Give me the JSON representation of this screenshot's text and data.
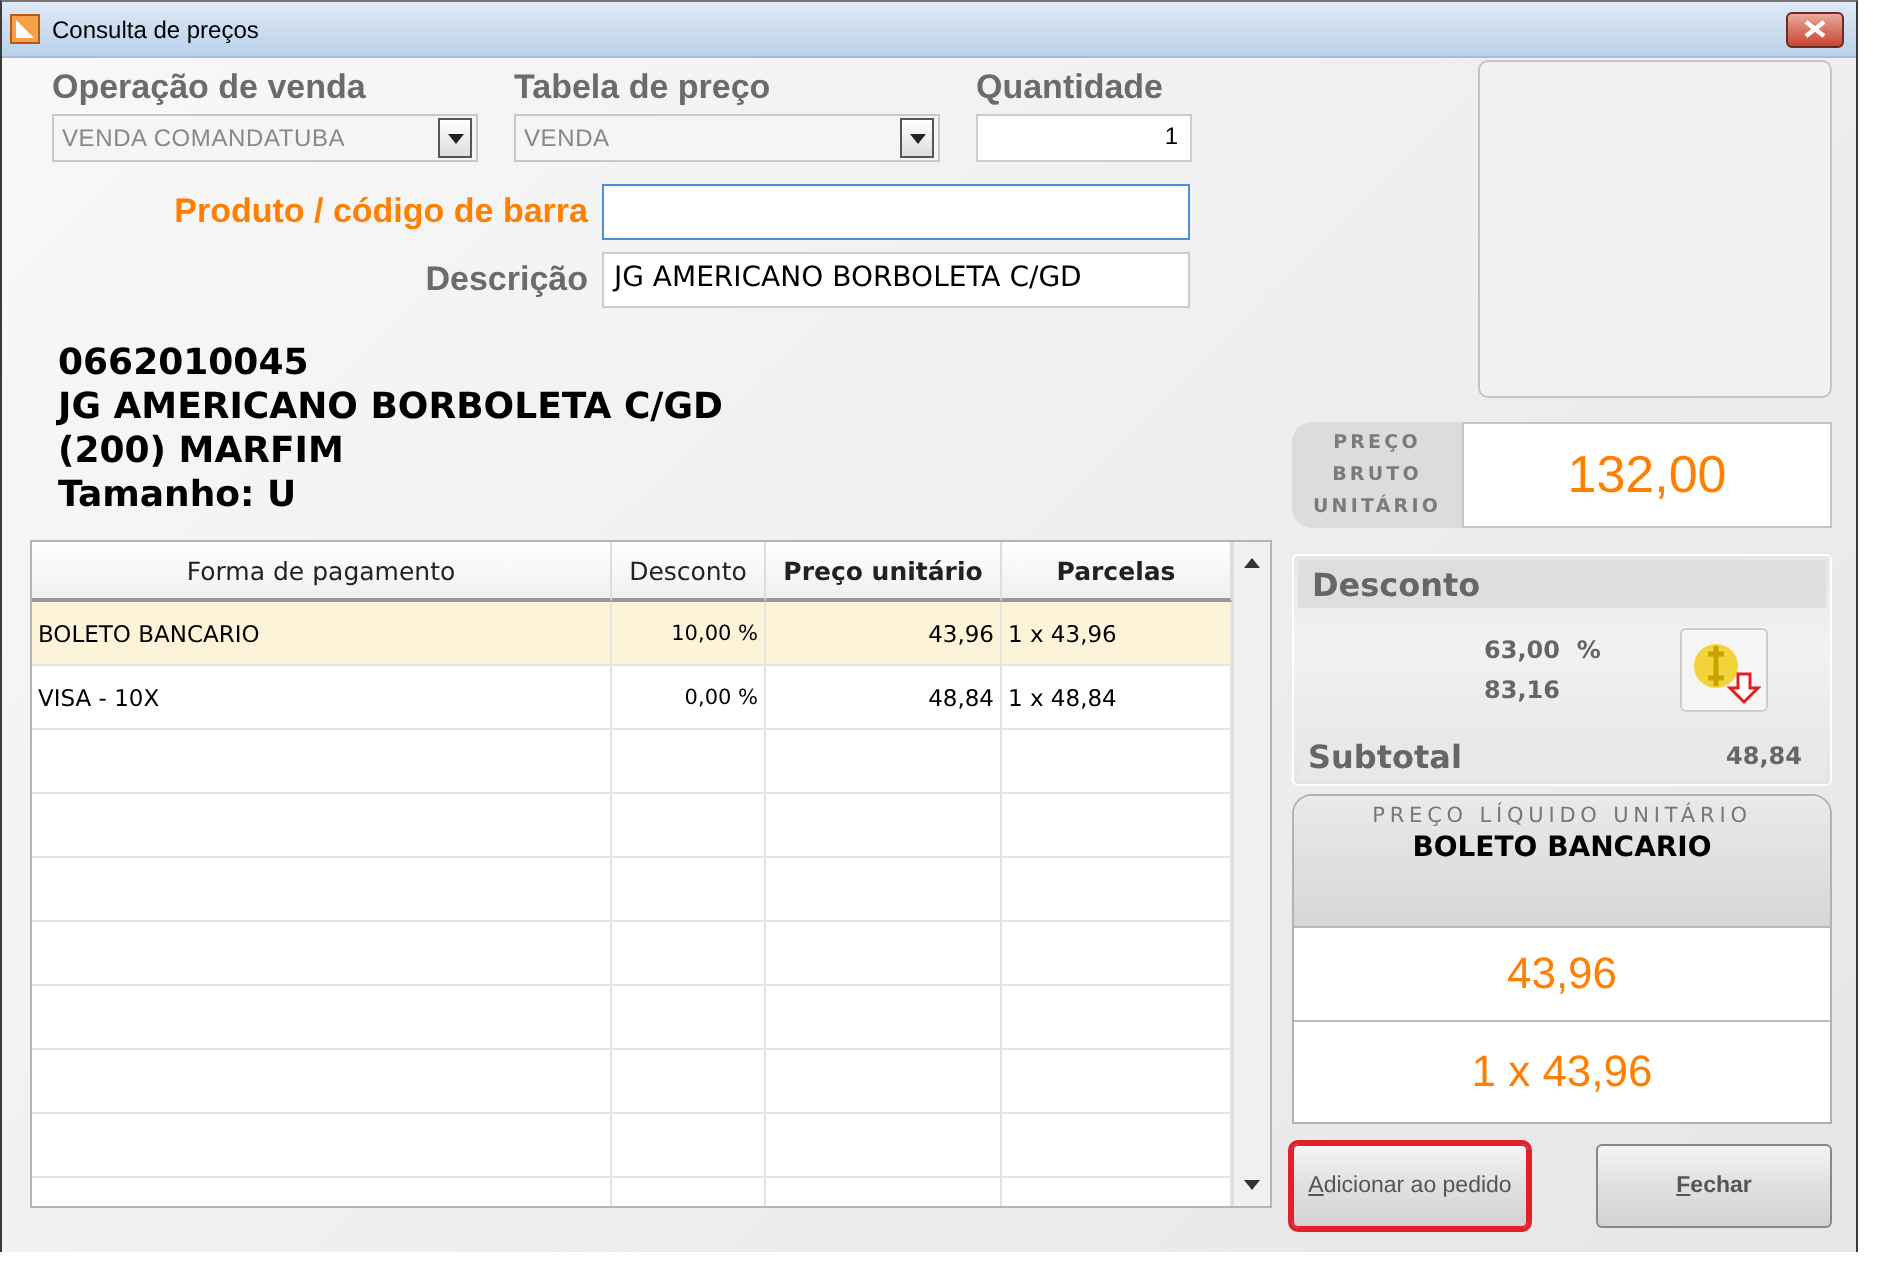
{
  "window": {
    "title": "Consulta de preços"
  },
  "form": {
    "operation": {
      "label": "Operação de venda",
      "value": "VENDA COMANDATUBA"
    },
    "price_table": {
      "label": "Tabela de preço",
      "value": "VENDA"
    },
    "quantity": {
      "label": "Quantidade",
      "value": "1"
    },
    "product": {
      "label": "Produto / código de barra",
      "focused": true
    },
    "description": {
      "label": "Descrição",
      "value": "JG AMERICANO BORBOLETA C/GD"
    }
  },
  "product_info": [
    "0662010045",
    "JG AMERICANO BORBOLETA C/GD",
    "(200) MARFIM",
    "Tamanho: U"
  ],
  "table": {
    "columns": [
      {
        "label": "Forma de pagamento",
        "bold": false
      },
      {
        "label": "Desconto",
        "bold": false
      },
      {
        "label": "Preço unitário",
        "bold": true
      },
      {
        "label": "Parcelas",
        "bold": true
      }
    ],
    "rows": [
      {
        "cells": [
          "BOLETO BANCARIO",
          "10,00 %",
          "43,96",
          "1 x 43,96"
        ],
        "selected": true
      },
      {
        "cells": [
          "VISA - 10X",
          "0,00 %",
          "48,84",
          "1 x 48,84"
        ],
        "selected": false
      }
    ]
  },
  "gross_price": {
    "label": "PREÇO BRUTO UNITÁRIO",
    "value": "132,00"
  },
  "discount": {
    "title": "Desconto",
    "percent": "63,00",
    "percent_sign": "%",
    "amount": "83,16",
    "subtotal_label": "Subtotal",
    "subtotal": "48,84"
  },
  "net_price": {
    "title": "PREÇO LÍQUIDO UNITÁRIO",
    "method": "BOLETO BANCARIO",
    "value": "43,96",
    "installments": "1 x 43,96"
  },
  "buttons": [
    {
      "label": "Adicionar ao pedido",
      "focused": true,
      "default": false
    },
    {
      "label": "Fechar",
      "focused": false,
      "default": true
    }
  ]
}
